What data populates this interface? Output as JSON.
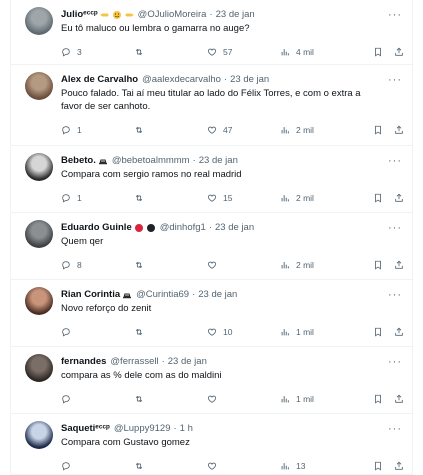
{
  "tweets": [
    {
      "author": "Julioᵉᶜᶜᵖ",
      "author_emojis": [
        "backhand-index-left",
        "smiling-face",
        "backhand-index-right"
      ],
      "handle": "@OJulioMoreira",
      "time": "23 de jan",
      "lines": [
        "Eu tô maluco ou lembra o gamarra no auge?"
      ],
      "replies": "3",
      "retweets": "",
      "likes": "57",
      "views": "4 mil",
      "avatar_colors": [
        "#9ea6aa",
        "#5f6a70"
      ]
    },
    {
      "author": "Alex de Carvalho",
      "author_emojis": [],
      "handle": "@aalexdecarvalho",
      "time": "23 de jan",
      "lines": [
        "Pouco falado. Tai aí meu titular ao lado do Félix Torres, e com o extra a",
        "favor de ser canhoto."
      ],
      "replies": "1",
      "retweets": "",
      "likes": "47",
      "views": "2 mil",
      "avatar_colors": [
        "#b59a82",
        "#6b4e3d"
      ]
    },
    {
      "author": "Bebeto.",
      "author_emojis": [
        "hat-badge"
      ],
      "handle": "@bebetoalmmmm",
      "time": "23 de jan",
      "lines": [
        "Compara com sergio ramos no real madrid"
      ],
      "replies": "1",
      "retweets": "",
      "likes": "15",
      "views": "2 mil",
      "avatar_colors": [
        "#d6d6d6",
        "#2a2a2a"
      ]
    },
    {
      "author": "Eduardo Guinle",
      "author_emojis": [
        "red-circle",
        "black-circle"
      ],
      "handle": "@dinhofg1",
      "time": "23 de jan",
      "lines": [
        "Quem qer"
      ],
      "replies": "8",
      "retweets": "",
      "likes": "",
      "views": "2 mil",
      "avatar_colors": [
        "#8b8f92",
        "#3e4245"
      ]
    },
    {
      "author": "Rian Corintia",
      "author_emojis": [
        "hat-badge"
      ],
      "handle": "@Curintia69",
      "time": "23 de jan",
      "lines": [
        "Novo reforço do zenit"
      ],
      "replies": "",
      "retweets": "",
      "likes": "10",
      "views": "1 mil",
      "avatar_colors": [
        "#c9947a",
        "#4a2e26"
      ]
    },
    {
      "author": "fernandes",
      "author_emojis": [],
      "handle": "@ferrassell",
      "time": "23 de jan",
      "lines": [
        "compara as % dele com as do maldini"
      ],
      "replies": "",
      "retweets": "",
      "likes": "",
      "views": "1 mil",
      "avatar_colors": [
        "#7a6e66",
        "#2e2824"
      ]
    },
    {
      "author": "Saquetiᵉᶜᶜᵖ",
      "author_emojis": [],
      "handle": "@Luppy9129",
      "time": "1 h",
      "lines": [
        "Compara com Gustavo gomez"
      ],
      "replies": "",
      "retweets": "",
      "likes": "",
      "views": "13",
      "avatar_colors": [
        "#c7d3e6",
        "#1d2b4a"
      ]
    }
  ],
  "more_label": "···",
  "colors": {
    "text": "#0f1419",
    "secondary": "#536471",
    "divider": "#eff3f4",
    "background": "#ffffff"
  },
  "icons": {
    "reply": "reply-icon",
    "retweet": "retweet-icon",
    "like": "heart-icon",
    "views": "views-chart-icon",
    "bookmark": "bookmark-icon",
    "share": "share-icon",
    "more": "more-options-icon"
  }
}
